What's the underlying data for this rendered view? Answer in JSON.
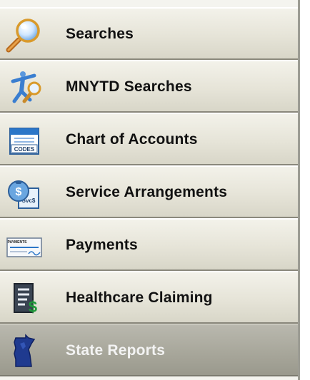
{
  "sidebar": {
    "items": [
      {
        "label": "Searches",
        "icon": "magnifier-icon",
        "active": false
      },
      {
        "label": "MNYTD Searches",
        "icon": "figure-magnifier-icon",
        "active": false
      },
      {
        "label": "Chart of Accounts",
        "icon": "codes-calendar-icon",
        "active": false
      },
      {
        "label": "Service Arrangements",
        "icon": "money-bag-document-icon",
        "active": false
      },
      {
        "label": "Payments",
        "icon": "check-icon",
        "active": false
      },
      {
        "label": "Healthcare Claiming",
        "icon": "report-dollar-icon",
        "active": false
      },
      {
        "label": "State Reports",
        "icon": "minnesota-map-icon",
        "active": true
      }
    ],
    "icon_texts": {
      "codes": "CODES",
      "bag": "$",
      "bag_doc": "Svc$",
      "check_header": "PAYMENTS",
      "report_dollar": "$"
    },
    "colors": {
      "accent_blue": "#2b76c8",
      "active_text": "#f3f3f3",
      "active_bg": "#a8a79b"
    }
  }
}
